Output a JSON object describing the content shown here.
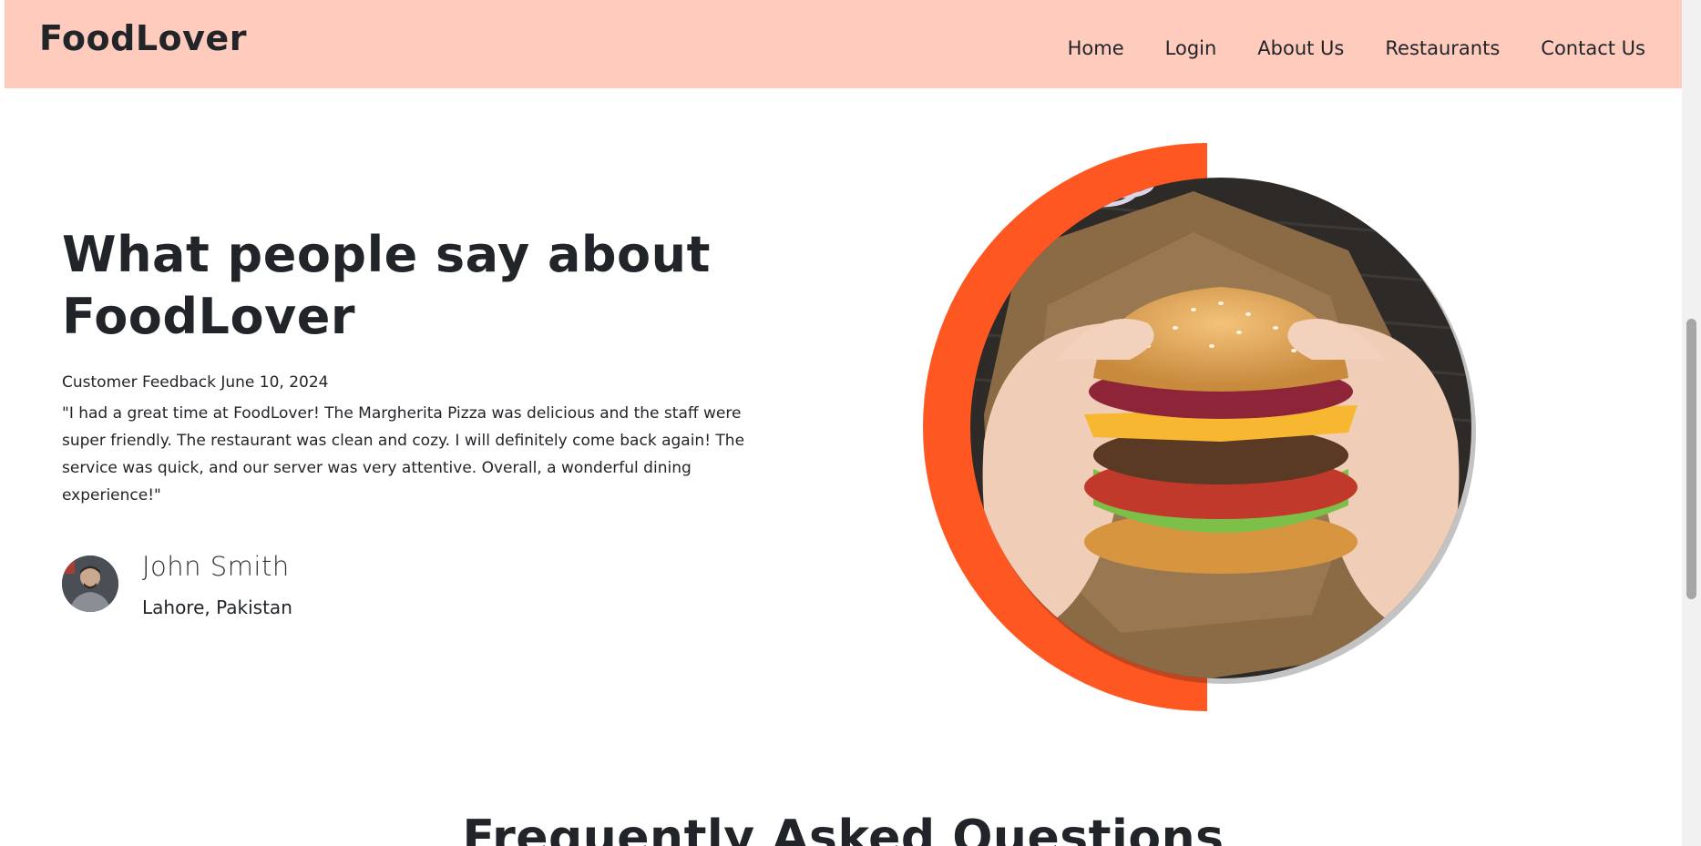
{
  "navbar": {
    "brand": "FoodLover",
    "links": [
      "Home",
      "Login",
      "About Us",
      "Restaurants",
      "Contact Us"
    ]
  },
  "testimonial": {
    "title": "What people say about FoodLover",
    "meta": "Customer Feedback June 10, 2024",
    "quote": "\"I had a great time at FoodLover! The Margherita Pizza was delicious and the staff were super friendly. The restaurant was clean and cozy. I will definitely come back again! The service was quick, and our server was very attentive. Overall, a wonderful dining experience!\"",
    "author_name": "John Smith",
    "author_location": "Lahore, Pakistan"
  },
  "faq": {
    "title": "Frequently Asked Questions"
  },
  "colors": {
    "nav_bg": "#ffcbbc",
    "accent": "#ff5722"
  }
}
